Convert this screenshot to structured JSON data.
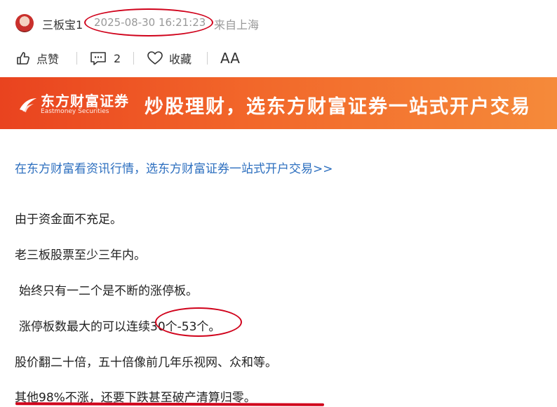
{
  "header": {
    "author": "三板宝1",
    "timestamp": "2025-08-30 16:21:23",
    "location": "来自上海"
  },
  "actions": {
    "like_label": "点赞",
    "comment_count": "2",
    "favorite_label": "收藏",
    "font_label": "AA"
  },
  "banner": {
    "logo_cn": "东方财富证券",
    "logo_en": "Eastmoney Securities",
    "slogan": "炒股理财，选东方财富证券一站式开户交易"
  },
  "promo_link": "在东方财富看资讯行情，选东方财富证券一站式开户交易>>",
  "paragraphs": [
    "由于资金面不充足。",
    "老三板股票至少三年内。",
    "始终只有一二个是不断的涨停板。",
    "涨停板数最大的可以连续30个-53个。",
    "股价翻二十倍，五十倍像前几年乐视网、众和等。",
    "其他98%不涨，还要下跌甚至破产清算归零。"
  ],
  "colors": {
    "annotation_red": "#d0021b",
    "link_blue": "#2d6fbf",
    "banner_orange": "#f2672a"
  }
}
